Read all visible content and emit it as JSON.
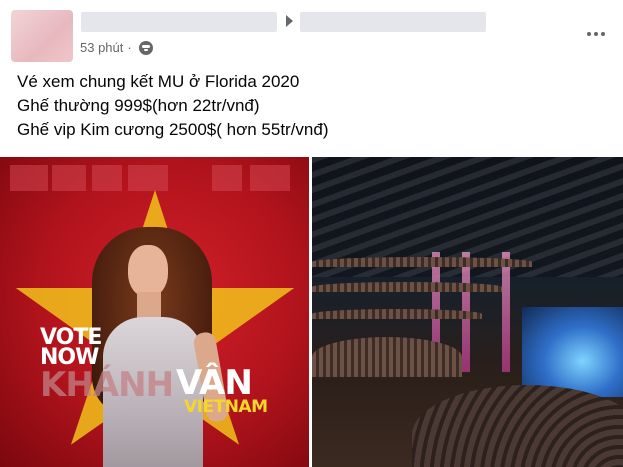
{
  "post": {
    "timestamp": "53 phút",
    "privacy_icon": "globe-icon",
    "more_icon": "ellipsis-icon",
    "text_lines": [
      "Vé xem chung kết MU ở Florida 2020",
      "Ghế thường 999$(hơn 22tr/vnđ)",
      "Ghế vip Kim cương 2500$( hơn 55tr/vnđ)"
    ]
  },
  "left_image": {
    "vote_line1": "VOTE",
    "vote_line2": "NOW",
    "name_first": "KHÁNH",
    "name_last": "VÂN",
    "country": "VIETNAM"
  },
  "colors": {
    "flag_red": "#b0131c",
    "star_yellow": "#f2c21b",
    "meta_gray": "#65676b"
  }
}
